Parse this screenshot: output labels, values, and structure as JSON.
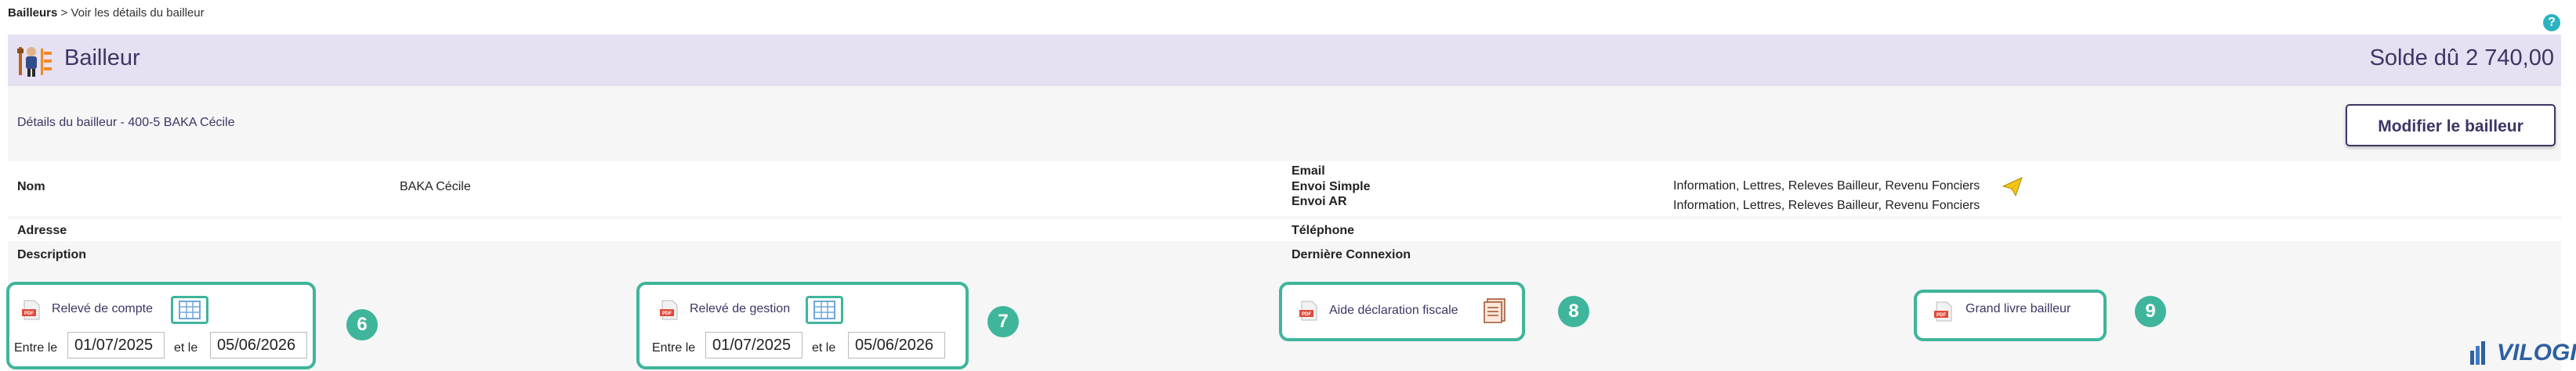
{
  "breadcrumb": {
    "parent": "Bailleurs",
    "separator": " > ",
    "current": "Voir les détails du bailleur"
  },
  "help": {
    "label": "?"
  },
  "header": {
    "title": "Bailleur",
    "solde": "Solde dû 2 740,00"
  },
  "details": {
    "title": "Détails du bailleur - 400-5 BAKA Cécile",
    "edit_label": "Modifier le bailleur"
  },
  "fields": {
    "nom_label": "Nom",
    "nom_value": "BAKA Cécile",
    "email_label": "Email",
    "envoi_simple_label": "Envoi Simple",
    "envoi_simple_value": "Information, Lettres, Releves Bailleur, Revenu Fonciers",
    "envoi_ar_label": "Envoi AR",
    "envoi_ar_value": "Information, Lettres, Releves Bailleur, Revenu Fonciers",
    "adresse_label": "Adresse",
    "telephone_label": "Téléphone",
    "description_label": "Description",
    "derniere_connexion_label": "Dernière Connexion"
  },
  "reports": {
    "releve_compte": {
      "label": "Relevé de compte",
      "from_label": "Entre le",
      "from": "01/07/2025",
      "to_label": "et le",
      "to": "05/06/2026",
      "badge": "6"
    },
    "releve_gestion": {
      "label": "Relevé de gestion",
      "from_label": "Entre le",
      "from": "01/07/2025",
      "to_label": "et le",
      "to": "05/06/2026",
      "badge": "7"
    },
    "aide_fiscale": {
      "label": "Aide déclaration fiscale",
      "badge": "8"
    },
    "grand_livre": {
      "label": "Grand livre bailleur",
      "badge": "9"
    }
  },
  "logo": {
    "text": "VILOGI"
  },
  "colors": {
    "accent": "#3fb59b",
    "brand": "#3e3565",
    "header_bg": "#e6e1f2"
  }
}
